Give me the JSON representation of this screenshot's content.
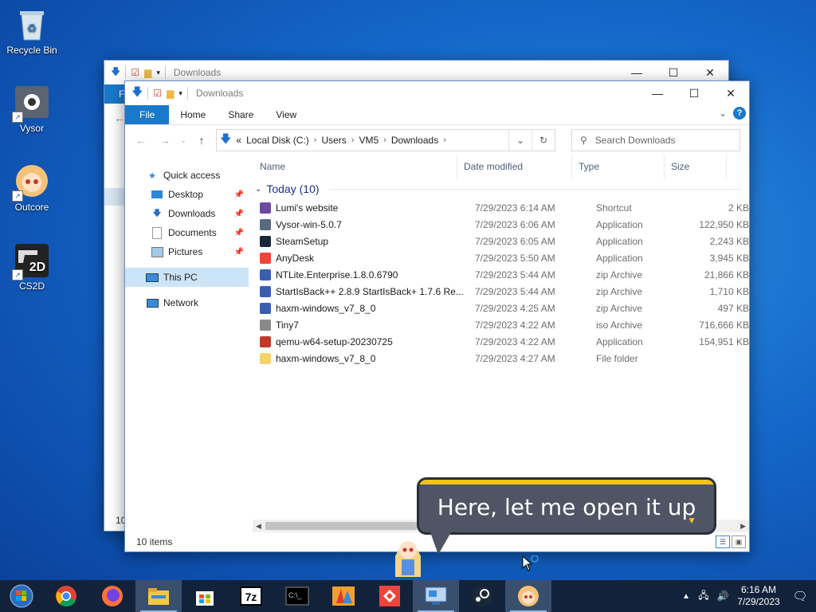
{
  "desktop": {
    "icons": [
      {
        "label": "Recycle Bin"
      },
      {
        "label": "Vysor"
      },
      {
        "label": "Outcore"
      },
      {
        "label": "CS2D"
      }
    ]
  },
  "back_window": {
    "title": "Downloads",
    "ribbon_letter": "F",
    "status_fragment": "10"
  },
  "window": {
    "title": "Downloads",
    "ribbon_tabs": [
      "File",
      "Home",
      "Share",
      "View"
    ],
    "address": {
      "overflow": "«",
      "crumbs": [
        "Local Disk (C:)",
        "Users",
        "VM5",
        "Downloads"
      ]
    },
    "search_placeholder": "Search Downloads",
    "nav_pane": {
      "quick_access": "Quick access",
      "pinned": [
        "Desktop",
        "Downloads",
        "Documents",
        "Pictures"
      ],
      "this_pc": "This PC",
      "network": "Network"
    },
    "columns": {
      "name": "Name",
      "date": "Date modified",
      "type": "Type",
      "size": "Size"
    },
    "group_label": "Today (10)",
    "files": [
      {
        "name": "Lumi's website",
        "date": "7/29/2023 6:14 AM",
        "type": "Shortcut",
        "size": "2 KB",
        "color": "#6a4aa3"
      },
      {
        "name": "Vysor-win-5.0.7",
        "date": "7/29/2023 6:06 AM",
        "type": "Application",
        "size": "122,950 KB",
        "color": "#5a6b80"
      },
      {
        "name": "SteamSetup",
        "date": "7/29/2023 6:05 AM",
        "type": "Application",
        "size": "2,243 KB",
        "color": "#1b2838"
      },
      {
        "name": "AnyDesk",
        "date": "7/29/2023 5:50 AM",
        "type": "Application",
        "size": "3,945 KB",
        "color": "#ef443b"
      },
      {
        "name": "NTLite.Enterprise.1.8.0.6790",
        "date": "7/29/2023 5:44 AM",
        "type": "zip Archive",
        "size": "21,866 KB",
        "color": "#3a5fb0"
      },
      {
        "name": "StartIsBack++ 2.8.9 StartIsBack+ 1.7.6 Re...",
        "date": "7/29/2023 5:44 AM",
        "type": "zip Archive",
        "size": "1,710 KB",
        "color": "#3a5fb0"
      },
      {
        "name": "haxm-windows_v7_8_0",
        "date": "7/29/2023 4:25 AM",
        "type": "zip Archive",
        "size": "497 KB",
        "color": "#3a5fb0"
      },
      {
        "name": "Tiny7",
        "date": "7/29/2023 4:22 AM",
        "type": "iso Archive",
        "size": "716,666 KB",
        "color": "#8a8a8a"
      },
      {
        "name": "qemu-w64-setup-20230725",
        "date": "7/29/2023 4:22 AM",
        "type": "Application",
        "size": "154,951 KB",
        "color": "#c0392b"
      },
      {
        "name": "haxm-windows_v7_8_0",
        "date": "7/29/2023 4:27 AM",
        "type": "File folder",
        "size": "",
        "color": "#f5d36b"
      }
    ],
    "status": "10 items"
  },
  "bubble": {
    "text": "Here, let me open it up"
  },
  "taskbar": {
    "clock_time": "6:16 AM",
    "clock_date": "7/29/2023"
  }
}
